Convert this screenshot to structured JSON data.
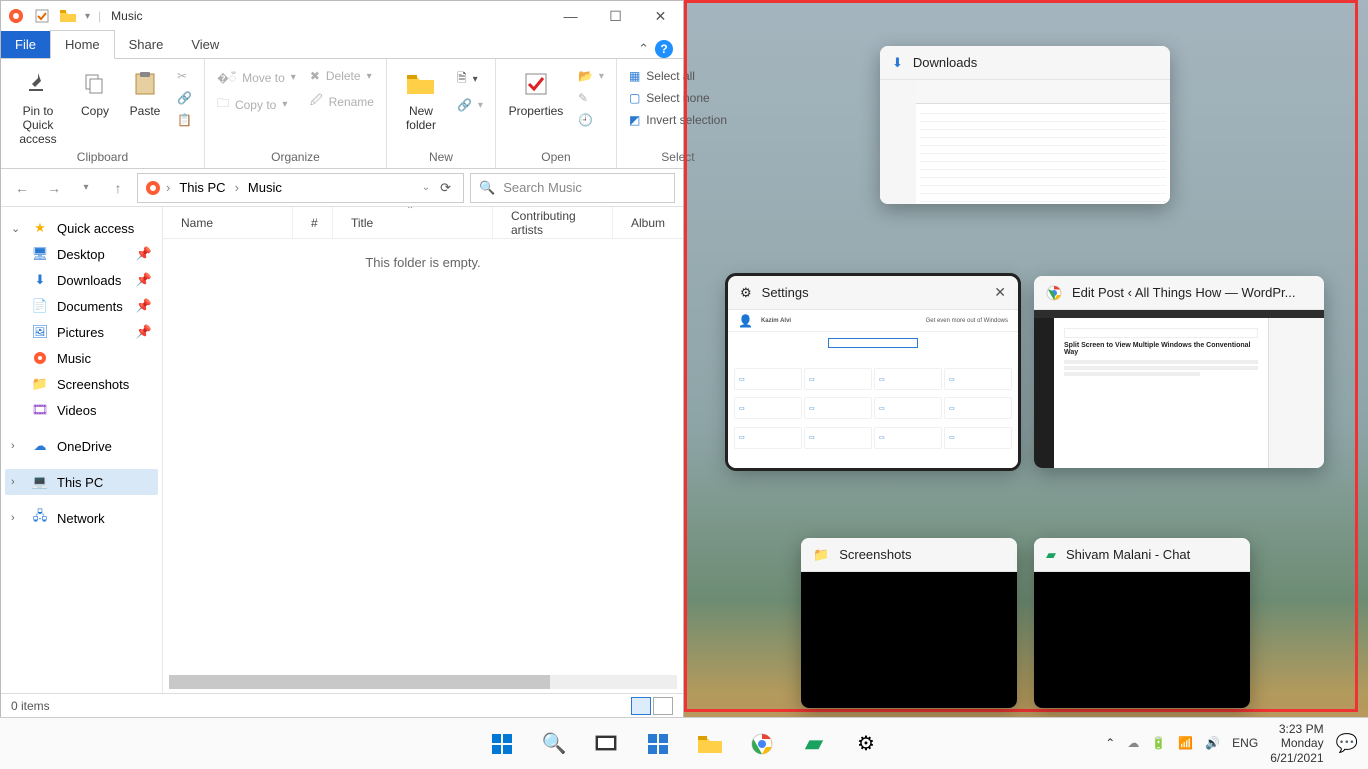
{
  "window": {
    "title": "Music",
    "tabs": {
      "file": "File",
      "home": "Home",
      "share": "Share",
      "view": "View"
    },
    "empty_msg": "This folder is empty.",
    "status": "0 items"
  },
  "ribbon": {
    "clipboard": {
      "label": "Clipboard",
      "pin": "Pin to Quick access",
      "copy": "Copy",
      "paste": "Paste"
    },
    "organize": {
      "label": "Organize",
      "move": "Move to",
      "copy_to": "Copy to",
      "delete": "Delete",
      "rename": "Rename"
    },
    "new": {
      "label": "New",
      "new_folder": "New folder"
    },
    "open": {
      "label": "Open",
      "properties": "Properties"
    },
    "select": {
      "label": "Select",
      "all": "Select all",
      "none": "Select none",
      "invert": "Invert selection"
    }
  },
  "nav": {
    "quick": "Quick access",
    "items": [
      "Desktop",
      "Downloads",
      "Documents",
      "Pictures",
      "Music",
      "Screenshots",
      "Videos"
    ],
    "onedrive": "OneDrive",
    "thispc": "This PC",
    "network": "Network"
  },
  "address": {
    "root": "This PC",
    "folder": "Music"
  },
  "search": {
    "placeholder": "Search Music"
  },
  "columns": [
    "Name",
    "#",
    "Title",
    "Contributing artists",
    "Album"
  ],
  "snap": {
    "downloads": "Downloads",
    "settings": "Settings",
    "settings_user": "Kazim Alvi",
    "settings_tag": "Get even more out of Windows",
    "wordpress": "Edit Post ‹ All Things How — WordPr...",
    "wordpress_heading": "Split Screen to View Multiple Windows the Conventional Way",
    "screenshots": "Screenshots",
    "chat": "Shivam Malani - Chat"
  },
  "taskbar": {
    "lang": "ENG",
    "time": "3:23 PM",
    "day": "Monday",
    "date": "6/21/2021"
  }
}
